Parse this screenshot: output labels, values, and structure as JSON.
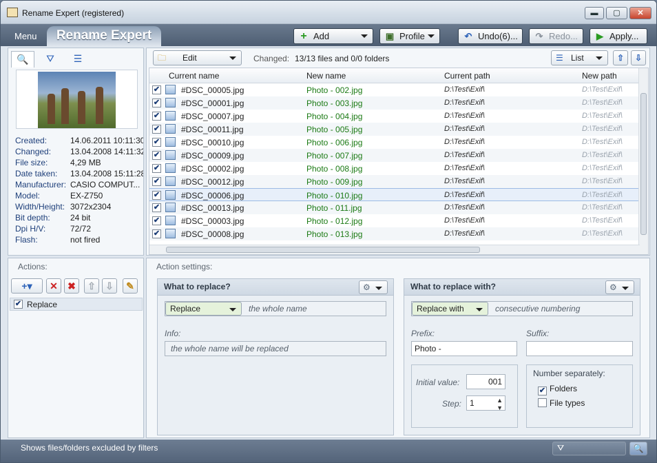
{
  "window": {
    "title": "Rename Expert (registered)",
    "controls": {
      "minimize": "▬",
      "maximize": "▢",
      "close": "✕"
    }
  },
  "ribbon": {
    "menu_label": "Menu",
    "app_tab": "Rename Expert",
    "add_label": "Add",
    "profile_label": "Profile",
    "undo_label": "Undo(6)...",
    "redo_label": "Redo...",
    "apply_label": "Apply..."
  },
  "preview": {
    "properties": [
      {
        "key": "Created:",
        "value": "14.06.2011 10:11:30"
      },
      {
        "key": "Changed:",
        "value": "13.04.2008 14:11:32"
      },
      {
        "key": "File size:",
        "value": "4,29 MB"
      },
      {
        "key": "Date taken:",
        "value": "13.04.2008 15:11:28"
      },
      {
        "key": "Manufacturer:",
        "value": "CASIO COMPUT..."
      },
      {
        "key": "Model:",
        "value": "EX-Z750"
      },
      {
        "key": "Width/Height:",
        "value": "3072x2304"
      },
      {
        "key": "Bit depth:",
        "value": "24 bit"
      },
      {
        "key": "Dpi H/V:",
        "value": "72/72"
      },
      {
        "key": "Flash:",
        "value": "not fired"
      }
    ]
  },
  "files": {
    "edit_label": "Edit",
    "changed_label": "Changed:",
    "changed_value": "13/13 files and 0/0 folders",
    "view_label": "List",
    "columns": [
      "Current name",
      "New name",
      "Current path",
      "New path"
    ],
    "rows": [
      {
        "current": "#DSC_00005.jpg",
        "new": "Photo - 002.jpg",
        "path": "D:\\Test\\Exif\\",
        "newpath": "D:\\Test\\Exif\\"
      },
      {
        "current": "#DSC_00001.jpg",
        "new": "Photo - 003.jpg",
        "path": "D:\\Test\\Exif\\",
        "newpath": "D:\\Test\\Exif\\"
      },
      {
        "current": "#DSC_00007.jpg",
        "new": "Photo - 004.jpg",
        "path": "D:\\Test\\Exif\\",
        "newpath": "D:\\Test\\Exif\\"
      },
      {
        "current": "#DSC_00011.jpg",
        "new": "Photo - 005.jpg",
        "path": "D:\\Test\\Exif\\",
        "newpath": "D:\\Test\\Exif\\"
      },
      {
        "current": "#DSC_00010.jpg",
        "new": "Photo - 006.jpg",
        "path": "D:\\Test\\Exif\\",
        "newpath": "D:\\Test\\Exif\\"
      },
      {
        "current": "#DSC_00009.jpg",
        "new": "Photo - 007.jpg",
        "path": "D:\\Test\\Exif\\",
        "newpath": "D:\\Test\\Exif\\"
      },
      {
        "current": "#DSC_00002.jpg",
        "new": "Photo - 008.jpg",
        "path": "D:\\Test\\Exif\\",
        "newpath": "D:\\Test\\Exif\\"
      },
      {
        "current": "#DSC_00012.jpg",
        "new": "Photo - 009.jpg",
        "path": "D:\\Test\\Exif\\",
        "newpath": "D:\\Test\\Exif\\"
      },
      {
        "current": "#DSC_00006.jpg",
        "new": "Photo - 010.jpg",
        "path": "D:\\Test\\Exif\\",
        "newpath": "D:\\Test\\Exif\\"
      },
      {
        "current": "#DSC_00013.jpg",
        "new": "Photo - 011.jpg",
        "path": "D:\\Test\\Exif\\",
        "newpath": "D:\\Test\\Exif\\"
      },
      {
        "current": "#DSC_00003.jpg",
        "new": "Photo - 012.jpg",
        "path": "D:\\Test\\Exif\\",
        "newpath": "D:\\Test\\Exif\\"
      },
      {
        "current": "#DSC_00008.jpg",
        "new": "Photo - 013.jpg",
        "path": "D:\\Test\\Exif\\",
        "newpath": "D:\\Test\\Exif\\"
      }
    ],
    "selected_row": 8
  },
  "actions": {
    "label": "Actions:",
    "items": [
      {
        "label": "Replace",
        "checked": true
      }
    ]
  },
  "settings": {
    "label": "Action settings:",
    "what": {
      "title": "What to replace?",
      "mode": "Replace",
      "mode_desc": "the whole name",
      "info_label": "Info:",
      "info_text": "the whole name will be replaced"
    },
    "with": {
      "title": "What to replace with?",
      "mode": "Replace with",
      "mode_desc": "consecutive numbering",
      "prefix_label": "Prefix:",
      "prefix_value": "Photo -",
      "suffix_label": "Suffix:",
      "suffix_value": "",
      "initial_label": "Initial value:",
      "initial_value": "001",
      "step_label": "Step:",
      "step_value": "1",
      "number_sep_label": "Number separately:",
      "folders_label": "Folders",
      "folders_checked": true,
      "filetypes_label": "File types",
      "filetypes_checked": false
    }
  },
  "status": {
    "text": "Shows files/folders excluded by filters"
  },
  "colors": {
    "new_name": "#1b7a14",
    "accent": "#2d62b8"
  }
}
